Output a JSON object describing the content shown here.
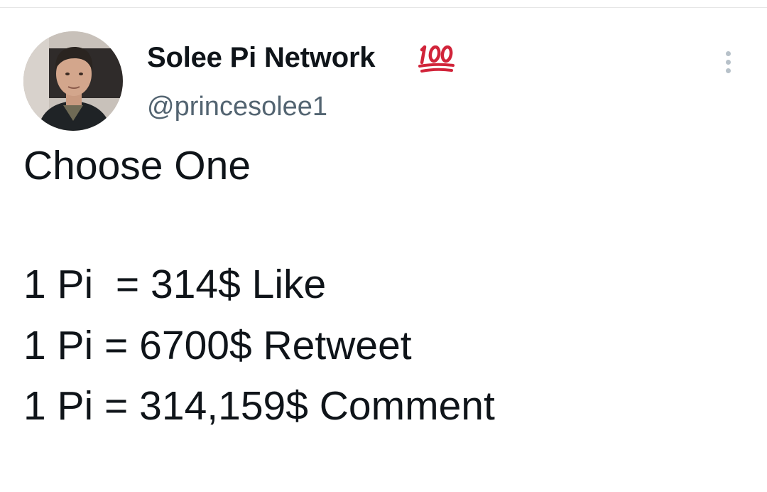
{
  "author": {
    "name": "Solee Pi Network",
    "badge_emoji": "💯",
    "handle": "@princesolee1"
  },
  "menu": {
    "icon": "more-vertical-icon"
  },
  "tweet": {
    "lines": [
      "Choose One",
      "1 Pi  = 314$ Like",
      "1 Pi = 6700$ Retweet",
      "1 Pi = 314,159$ Comment"
    ]
  },
  "colors": {
    "text_primary": "#0f1419",
    "text_secondary": "#536471",
    "badge_red": "#d1243a",
    "menu_dots": "#b7c1c9"
  }
}
